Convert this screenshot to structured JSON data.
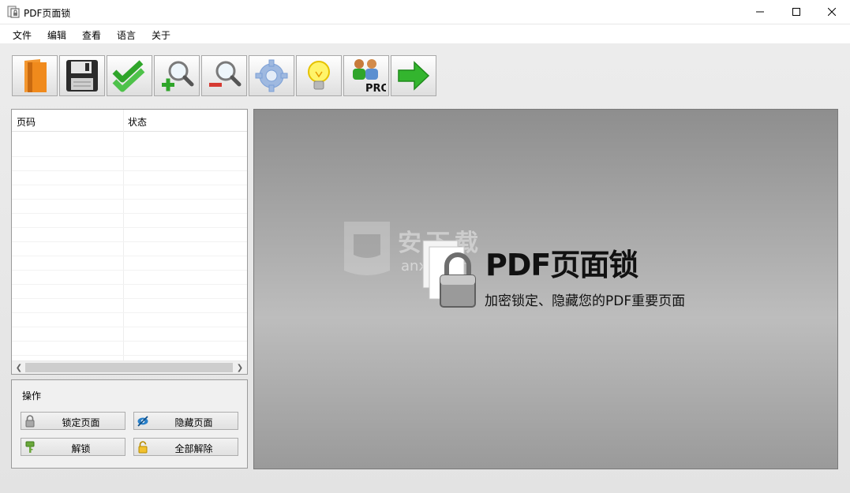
{
  "window": {
    "title": "PDF页面锁"
  },
  "menu": [
    "文件",
    "编辑",
    "查看",
    "语言",
    "关于"
  ],
  "toolbar": [
    {
      "name": "open-button",
      "icon": "folder-icon"
    },
    {
      "name": "save-button",
      "icon": "floppy-icon"
    },
    {
      "name": "select-all-button",
      "icon": "double-check-icon"
    },
    {
      "name": "zoom-in-button",
      "icon": "zoom-in-icon"
    },
    {
      "name": "zoom-out-button",
      "icon": "zoom-out-icon"
    },
    {
      "name": "settings-button",
      "icon": "gear-icon"
    },
    {
      "name": "tips-button",
      "icon": "lightbulb-icon"
    },
    {
      "name": "pro-button",
      "icon": "pro-users-icon",
      "badge": "PRO"
    },
    {
      "name": "next-button",
      "icon": "arrow-right-icon"
    }
  ],
  "list": {
    "columns": [
      "页码",
      "状态"
    ]
  },
  "operations": {
    "title": "操作",
    "lock_page": "锁定页面",
    "hide_page": "隐藏页面",
    "unlock": "解锁",
    "unlock_all": "全部解除"
  },
  "splash": {
    "title": "PDF页面锁",
    "subtitle": "加密锁定、隐藏您的PDF重要页面",
    "watermark": "安下载",
    "watermark_sub": "anxz.com"
  },
  "colors": {
    "accent_green": "#2fa52a",
    "folder_orange": "#f08a1c",
    "gear_blue": "#7b9fd6"
  }
}
